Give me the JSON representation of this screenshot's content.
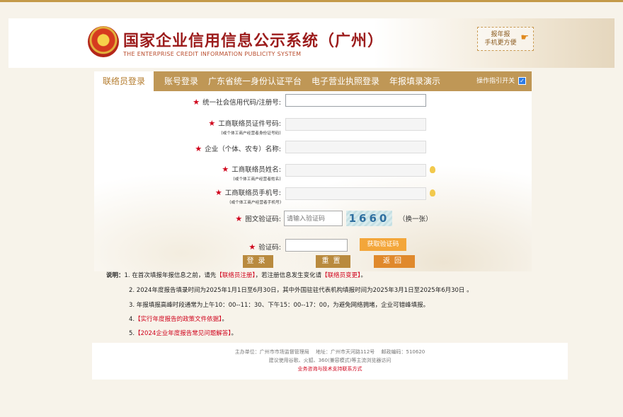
{
  "header": {
    "title_cn": "国家企业信用信息公示系统（广州）",
    "title_en": "THE ENTERPRISE CREDIT INFORMATION PUBLICITY SYSTEM",
    "mobile_line1": "报年报",
    "mobile_line2": "手机更方便"
  },
  "tabs": [
    {
      "label": "联络员登录"
    },
    {
      "label": "账号登录"
    },
    {
      "label": "广东省统一身份认证平台"
    },
    {
      "label": "电子营业执照登录"
    },
    {
      "label": "年报填录演示"
    }
  ],
  "guide": {
    "label": "操作指引开关",
    "checked": true
  },
  "form": {
    "credit_code": {
      "label": "统一社会信用代码/注册号:",
      "value": ""
    },
    "id_number": {
      "label": "工商联络员证件号码:",
      "sub": "(或个体工商户经营者身份证号码)",
      "value": ""
    },
    "company_name": {
      "label": "企业（个体、农专）名称:",
      "value": ""
    },
    "contact_name": {
      "label": "工商联络员姓名:",
      "sub": "(或个体工商户经营者姓名)",
      "value": ""
    },
    "contact_phone": {
      "label": "工商联络员手机号:",
      "sub": "(或个体工商户经营者手机号)",
      "value": ""
    },
    "image_captcha": {
      "label": "图文验证码:",
      "placeholder": "请输入验证码",
      "image_text": "1660",
      "swap": "（换一张）"
    },
    "sms_code": {
      "label": "验证码:",
      "button": "获取验证码"
    }
  },
  "buttons": {
    "login": "登录",
    "reset": "重置",
    "back": "返回"
  },
  "notes": {
    "title": "说明：",
    "n1_prefix": "1. 在首次填报年报信息之前，请先",
    "n1_link1": "【联络员注册】",
    "n1_mid": "，若注册信息发生变化请",
    "n1_link2": "【联络员变更】",
    "n1_suffix": "。",
    "n2": "2. 2024年度报告填录时间为2025年1月1日至6月30日，其中外国驻驻代表机构填报时间为2025年3月1日至2025年6月30日 。",
    "n3": "3. 年报填报高峰时段通常为上午10：00--11：30、下午15：00--17：00，为避免网络拥堵，企业可错峰填报。",
    "n4_prefix": "4.",
    "n4_link": "【实行年度报告的政策文件依据】",
    "n4_suffix": "。",
    "n5_prefix": "5.",
    "n5_link": "【2024企业年度报告常见问题解答】",
    "n5_suffix": "。"
  },
  "footer": {
    "line1": "主办单位：广州市市场监督管理局　 地址：广州市天河路112号　 邮政编码：510620",
    "line2": "建议使用谷歌、火狐、360(兼容模式)等主流浏览器访问",
    "line3": "业务咨询与技术支持联系方式"
  },
  "colors": {
    "accent": "#bf9756",
    "red": "#d0021b",
    "orange": "#f3a63a"
  }
}
